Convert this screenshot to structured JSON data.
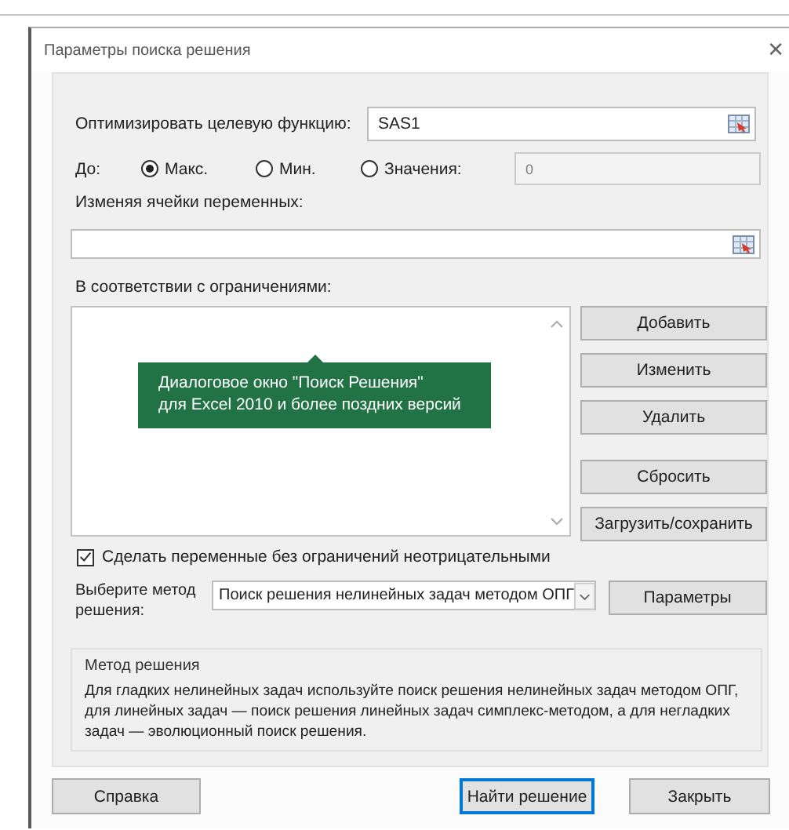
{
  "window": {
    "title": "Параметры поиска решения",
    "close": "✕"
  },
  "objective": {
    "label": "Оптимизировать целевую функцию:",
    "value": "SAS1"
  },
  "to": {
    "label": "До:",
    "options": [
      {
        "label": "Макс.",
        "selected": true
      },
      {
        "label": "Мин.",
        "selected": false
      },
      {
        "label": "Значения:",
        "selected": false
      }
    ],
    "value_field": {
      "value": "0",
      "disabled": true
    }
  },
  "variables": {
    "label": "Изменяя ячейки переменных:"
  },
  "constraints": {
    "label": "В соответствии с ограничениями:"
  },
  "constraint_buttons": [
    "Добавить",
    "Изменить",
    "Удалить",
    "Сбросить",
    "Загрузить/сохранить"
  ],
  "tooltip": "Диалоговое окно \"Поиск Решения\"\nдля Excel 2010 и более поздних версий",
  "nonnegative": {
    "label": "Сделать переменные без ограничений неотрицательными",
    "checked": true
  },
  "method": {
    "label": "Выберите метод решения:",
    "value": "Поиск решения нелинейных задач методом ОПГ",
    "options_button": "Параметры"
  },
  "method_info": {
    "title": "Метод решения",
    "text": "Для гладких нелинейных задач используйте поиск решения нелинейных задач методом ОПГ, для линейных задач — поиск решения линейных задач симплекс-методом, а для негладких задач — эволюционный поиск решения."
  },
  "footer_buttons": [
    {
      "label": "Справка",
      "default": false
    },
    {
      "label": "Найти решение",
      "default": true
    },
    {
      "label": "Закрыть",
      "default": false
    }
  ]
}
